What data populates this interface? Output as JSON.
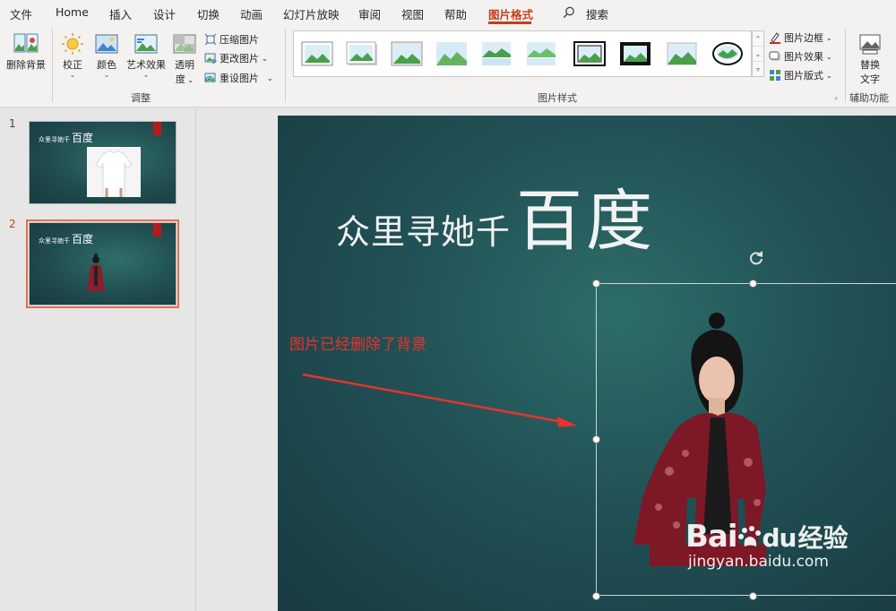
{
  "menu": {
    "tabs": [
      "文件",
      "Home",
      "插入",
      "设计",
      "切换",
      "动画",
      "幻灯片放映",
      "审阅",
      "视图",
      "帮助",
      "图片格式"
    ],
    "active_tab": "图片格式",
    "search_label": "搜索"
  },
  "ribbon": {
    "adjust": {
      "remove_bg": "删除背景",
      "corrections": "校正",
      "color": "颜色",
      "artistic": "艺术效果",
      "transparency_1": "透明",
      "transparency_2": "度",
      "compress": "压缩图片",
      "change": "更改图片",
      "reset": "重设图片",
      "group_label": "调整"
    },
    "styles": {
      "group_label": "图片样式",
      "border": "图片边框",
      "effects": "图片效果",
      "layout": "图片版式"
    },
    "accessibility": {
      "alt_text_1": "替换",
      "alt_text_2": "文字",
      "group_label": "辅助功能"
    }
  },
  "slides_panel": {
    "slides": [
      {
        "number": "1",
        "title_small": "众里寻她千",
        "title_big": "百度"
      },
      {
        "number": "2",
        "title_small": "众里寻她千",
        "title_big": "百度"
      }
    ],
    "selected": "2"
  },
  "slide": {
    "title_sub": "众里寻她千",
    "title_main": "百度",
    "annotation": "图片已经删除了背景",
    "watermark": {
      "logo_a": "Bai",
      "logo_b": "du",
      "logo_cn": "经验",
      "url": "jingyan.baidu.com"
    }
  },
  "colors": {
    "accent": "#c43e1c",
    "slide_bg": "#215156",
    "annotation_red": "#e8332a",
    "selected_thumb_border": "#e86c4a"
  }
}
